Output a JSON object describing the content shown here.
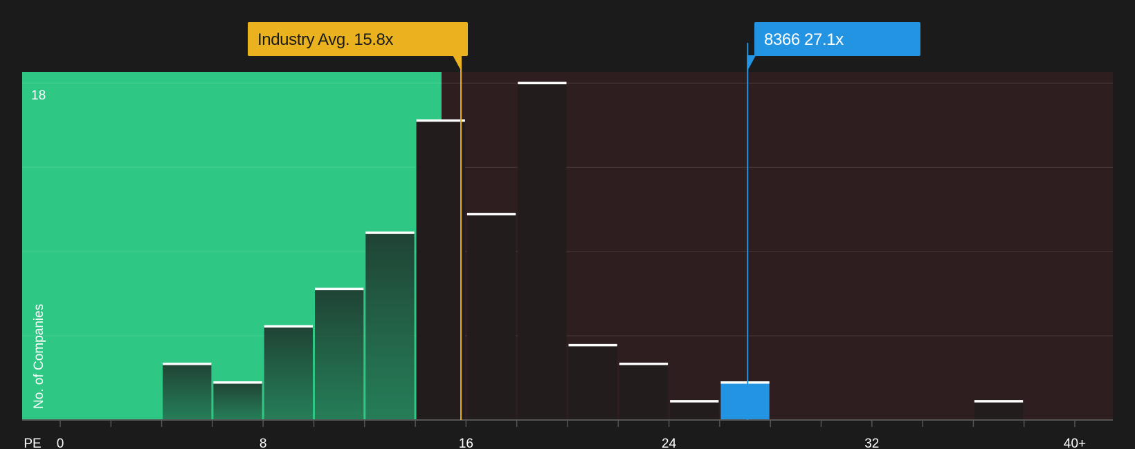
{
  "chart_data": {
    "type": "bar",
    "xlabel": "PE",
    "ylabel": "No. of Companies",
    "y_top_label": "18",
    "xlim": [
      -1.5,
      41.5
    ],
    "ylim": [
      0,
      18.6
    ],
    "x_ticks": [
      {
        "value": 0,
        "label": "0"
      },
      {
        "value": 8,
        "label": "8"
      },
      {
        "value": 16,
        "label": "16"
      },
      {
        "value": 24,
        "label": "24"
      },
      {
        "value": 32,
        "label": "32"
      },
      {
        "value": 40,
        "label": "40+"
      }
    ],
    "bin_width": 2,
    "bins": [
      {
        "start": 0,
        "end": 2,
        "count": 0
      },
      {
        "start": 2,
        "end": 4,
        "count": 0
      },
      {
        "start": 4,
        "end": 6,
        "count": 3
      },
      {
        "start": 6,
        "end": 8,
        "count": 2
      },
      {
        "start": 8,
        "end": 10,
        "count": 5
      },
      {
        "start": 10,
        "end": 12,
        "count": 7
      },
      {
        "start": 12,
        "end": 14,
        "count": 10
      },
      {
        "start": 14,
        "end": 16,
        "count": 16
      },
      {
        "start": 16,
        "end": 18,
        "count": 11
      },
      {
        "start": 18,
        "end": 20,
        "count": 18
      },
      {
        "start": 20,
        "end": 22,
        "count": 4
      },
      {
        "start": 22,
        "end": 24,
        "count": 3
      },
      {
        "start": 24,
        "end": 26,
        "count": 1
      },
      {
        "start": 26,
        "end": 28,
        "count": 2
      },
      {
        "start": 28,
        "end": 30,
        "count": 0
      },
      {
        "start": 30,
        "end": 32,
        "count": 0
      },
      {
        "start": 32,
        "end": 34,
        "count": 0
      },
      {
        "start": 34,
        "end": 36,
        "count": 0
      },
      {
        "start": 36,
        "end": 38,
        "count": 1
      },
      {
        "start": 38,
        "end": 40,
        "count": 0
      }
    ],
    "highlight_bin_start": 26,
    "industry_average": {
      "value": 15.8,
      "label": "Industry Avg. 15.8x"
    },
    "company": {
      "value": 27.1,
      "label": "8366 27.1x"
    },
    "colors": {
      "background": "#1b1b1b",
      "undervalued_zone": "#2ec884",
      "overvalued_zone": "#2f1e1f",
      "industry_marker": "#eab21e",
      "company_marker": "#2394e1",
      "bar_cap": "#ffffff"
    }
  }
}
